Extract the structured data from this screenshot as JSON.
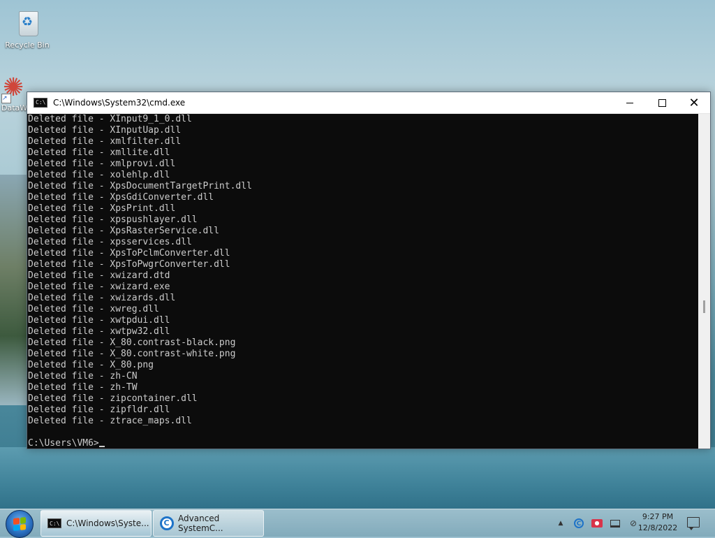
{
  "desktop": {
    "icons": [
      {
        "label": "Recycle Bin",
        "icon": "recycle-bin-icon"
      },
      {
        "label": "DataW",
        "icon": "datawrapper-icon"
      }
    ]
  },
  "cmd_window": {
    "title": "C:\\Windows\\System32\\cmd.exe",
    "icon": "cmd-icon",
    "controls": {
      "minimize": "minimize-icon",
      "maximize": "maximize-icon",
      "close": "close-icon"
    },
    "lines": [
      "Deleted file - XInput9_1_0.dll",
      "Deleted file - XInputUap.dll",
      "Deleted file - xmlfilter.dll",
      "Deleted file - xmllite.dll",
      "Deleted file - xmlprovi.dll",
      "Deleted file - xolehlp.dll",
      "Deleted file - XpsDocumentTargetPrint.dll",
      "Deleted file - XpsGdiConverter.dll",
      "Deleted file - XpsPrint.dll",
      "Deleted file - xpspushlayer.dll",
      "Deleted file - XpsRasterService.dll",
      "Deleted file - xpsservices.dll",
      "Deleted file - XpsToPclmConverter.dll",
      "Deleted file - XpsToPwgrConverter.dll",
      "Deleted file - xwizard.dtd",
      "Deleted file - xwizard.exe",
      "Deleted file - xwizards.dll",
      "Deleted file - xwreg.dll",
      "Deleted file - xwtpdui.dll",
      "Deleted file - xwtpw32.dll",
      "Deleted file - X_80.contrast-black.png",
      "Deleted file - X_80.contrast-white.png",
      "Deleted file - X_80.png",
      "Deleted file - zh-CN",
      "Deleted file - zh-TW",
      "Deleted file - zipcontainer.dll",
      "Deleted file - zipfldr.dll",
      "Deleted file - ztrace_maps.dll"
    ],
    "prompt": "C:\\Users\\VM6>"
  },
  "taskbar": {
    "start_icon": "windows-start-icon",
    "buttons": [
      {
        "label": "C:\\Windows\\Syste...",
        "icon": "cmd-icon",
        "active": true
      },
      {
        "label": "Advanced SystemC...",
        "icon": "advanced-systemcare-icon",
        "active": false
      }
    ],
    "tray": {
      "icons": [
        "show-hidden-icons-chevron",
        "advanced-systemcare-tray-icon",
        "camera-app-icon",
        "network-icon",
        "volume-icon"
      ],
      "time": "9:27 PM",
      "date": "12/8/2022",
      "notification_icon": "action-center-icon"
    }
  },
  "colors": {
    "console_bg": "#0c0c0c",
    "console_text": "#cccccc",
    "titlebar_bg": "#ffffff"
  }
}
